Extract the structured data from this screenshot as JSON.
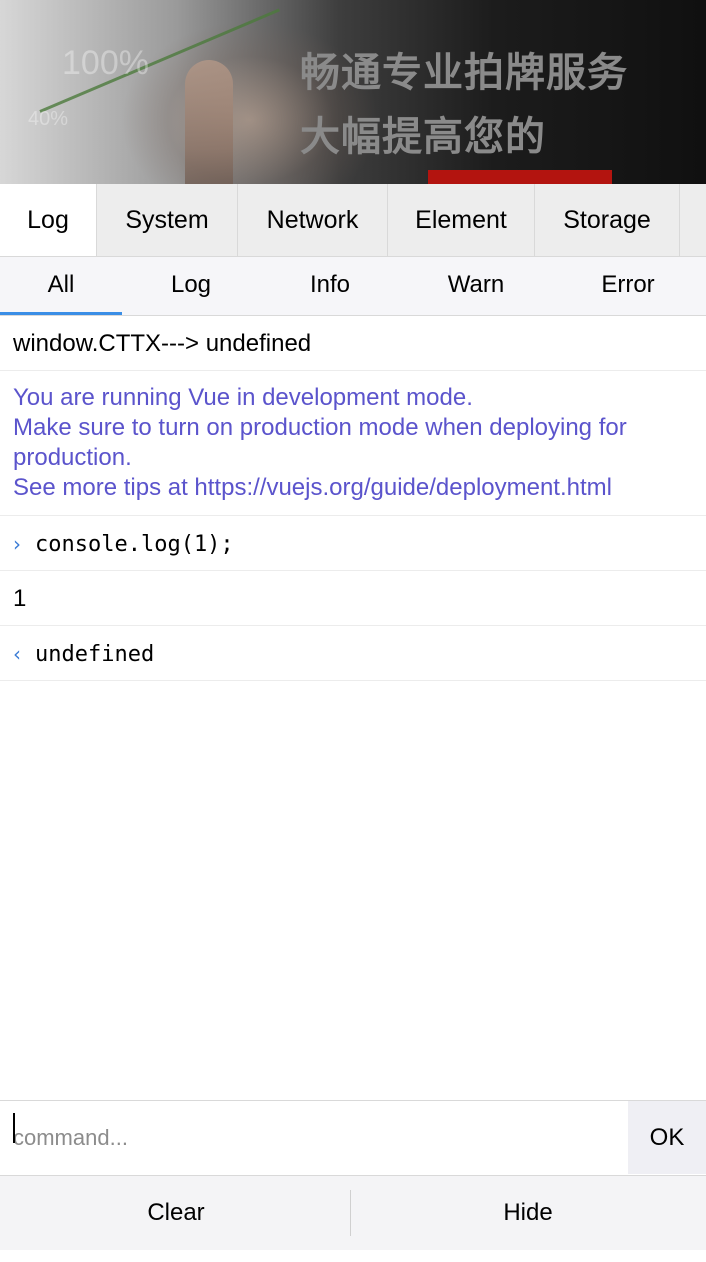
{
  "banner": {
    "percent_large": "100%",
    "percent_small": "40%",
    "ad_line1": "畅通专业拍牌服务",
    "ad_line2": "大幅提高您的"
  },
  "tabs": [
    {
      "label": "Log",
      "active": true
    },
    {
      "label": "System",
      "active": false
    },
    {
      "label": "Network",
      "active": false
    },
    {
      "label": "Element",
      "active": false
    },
    {
      "label": "Storage",
      "active": false
    }
  ],
  "subtabs": [
    {
      "label": "All",
      "active": true
    },
    {
      "label": "Log",
      "active": false
    },
    {
      "label": "Info",
      "active": false
    },
    {
      "label": "Warn",
      "active": false
    },
    {
      "label": "Error",
      "active": false
    }
  ],
  "logs": {
    "entry1": "window.CTTX---> undefined",
    "vue_lines": [
      "You are running Vue in development mode.",
      "Make sure to turn on production mode when deploying for",
      "production.",
      "See more tips at https://vuejs.org/guide/deployment.html"
    ],
    "command_prompt": "›",
    "command": "console.log(1);",
    "output": "1",
    "return_prompt": "‹",
    "return_value": "undefined"
  },
  "colors": {
    "vue_info": "#5b54cc",
    "prompt": "#3a7bd5",
    "active_tab_indicator": "#3a8ee6"
  },
  "command_bar": {
    "placeholder": "command...",
    "value": "",
    "ok_label": "OK"
  },
  "footer": {
    "clear_label": "Clear",
    "hide_label": "Hide"
  }
}
